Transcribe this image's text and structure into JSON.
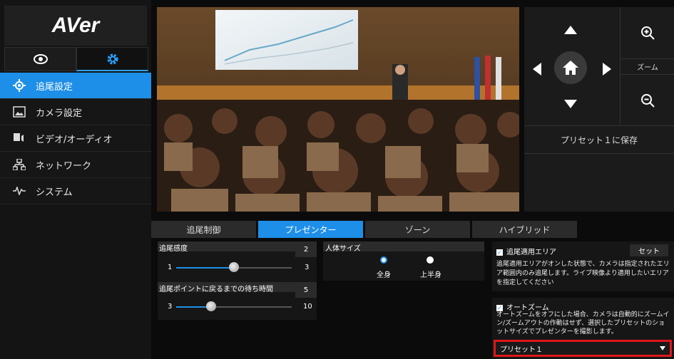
{
  "brand": {
    "logo": "AVer"
  },
  "mode_tabs": [
    {
      "name": "eye-icon"
    },
    {
      "name": "gear-icon"
    }
  ],
  "nav": {
    "items": [
      {
        "label": "追尾設定",
        "icon": "target-icon"
      },
      {
        "label": "カメラ設定",
        "icon": "image-icon"
      },
      {
        "label": "ビデオ/オーディオ",
        "icon": "av-icon"
      },
      {
        "label": "ネットワーク",
        "icon": "network-icon"
      },
      {
        "label": "システム",
        "icon": "pulse-icon"
      }
    ]
  },
  "ptz": {
    "zoom_label": "ズーム",
    "preset_save": "プリセット１に保存"
  },
  "tabs": [
    "追尾制御",
    "プレゼンター",
    "ゾーン",
    "ハイブリッド"
  ],
  "tracking": {
    "sensitivity": {
      "label": "追尾感度",
      "value": "2",
      "min": "1",
      "max": "3",
      "level": 0.5
    },
    "wait": {
      "label": "追尾ポイントに戻るまでの待ち時間",
      "value": "5",
      "min": "3",
      "max": "10",
      "level": 0.28
    }
  },
  "body_size": {
    "label": "人体サイズ",
    "options": [
      "全身",
      "上半身"
    ],
    "selected": "全身"
  },
  "area": {
    "title": "追尾適用エリア",
    "set_button": "セット",
    "description": "追尾適用エリアがオンした状態で、カメラは指定されたエリア範囲内のみ追尾します。ライブ映像より適用したいエリアを指定してください"
  },
  "autozoom": {
    "title": "オートズーム",
    "description": "オートズームをオフにした場合、カメラは自動的にズームイン/ズームアウトの作動はせず、選択したプリセットのショットサイズでプレゼンターを撮影します。",
    "preset_value": "プリセット１"
  },
  "colors": {
    "accent": "#1e8fe8",
    "highlight_border": "#e0161b"
  }
}
